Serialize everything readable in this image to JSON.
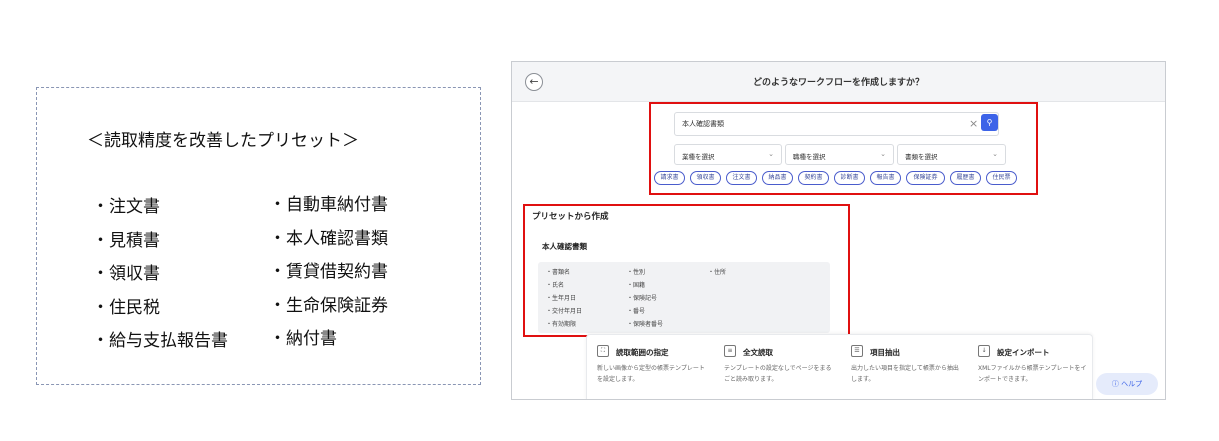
{
  "presets_panel": {
    "title": "＜読取精度を改善したプリセット＞",
    "col1": [
      "・注文書",
      "・見積書",
      "・領収書",
      "・住民税",
      "・給与支払報告書"
    ],
    "col2": [
      "・自動車納付書",
      "・本人確認書類",
      "・賃貸借契約書",
      "・生命保険証券",
      "・納付書"
    ]
  },
  "app": {
    "title": "どのようなワークフローを作成しますか？",
    "back_icon": "arrow-left-icon",
    "search": {
      "value": "本人確認書類",
      "clear_icon": "close-icon",
      "button_icon": "search-icon"
    },
    "selects": [
      "業種を選択",
      "職種を選択",
      "書類を選択"
    ],
    "chips": [
      "請求書",
      "領収書",
      "注文書",
      "納品書",
      "契約書",
      "診断書",
      "報告書",
      "保険証券",
      "履歴書",
      "住民票"
    ],
    "preset_section_title": "プリセットから作成",
    "card": {
      "title": "本人確認書類",
      "fields_col1": [
        "・書類名",
        "・氏名",
        "・生年月日",
        "・交付年月日",
        "・有効期限"
      ],
      "fields_col2": [
        "・性別",
        "・国籍",
        "・保険記号",
        "・番号",
        "・保険者番号"
      ],
      "fields_col3": [
        "・住所"
      ]
    },
    "workflows": [
      {
        "name": "読取範囲の指定",
        "icon": "crop-icon",
        "desc": "新しい画像から定型の帳票テンプレートを設定します。"
      },
      {
        "name": "全文読取",
        "icon": "document-text-icon",
        "desc": "テンプレートの設定なしでページをまるごと読み取ります。"
      },
      {
        "name": "項目抽出",
        "icon": "list-icon",
        "desc": "出力したい項目を指定して帳票から抽出します。"
      },
      {
        "name": "設定インポート",
        "icon": "import-icon",
        "desc": "XMLファイルから帳票テンプレートをインポートできます。"
      }
    ],
    "help_label": "ヘルプ",
    "colors": {
      "accent": "#3c63e8",
      "highlight": "#e01010",
      "chip_border": "#4a5ccc"
    }
  }
}
